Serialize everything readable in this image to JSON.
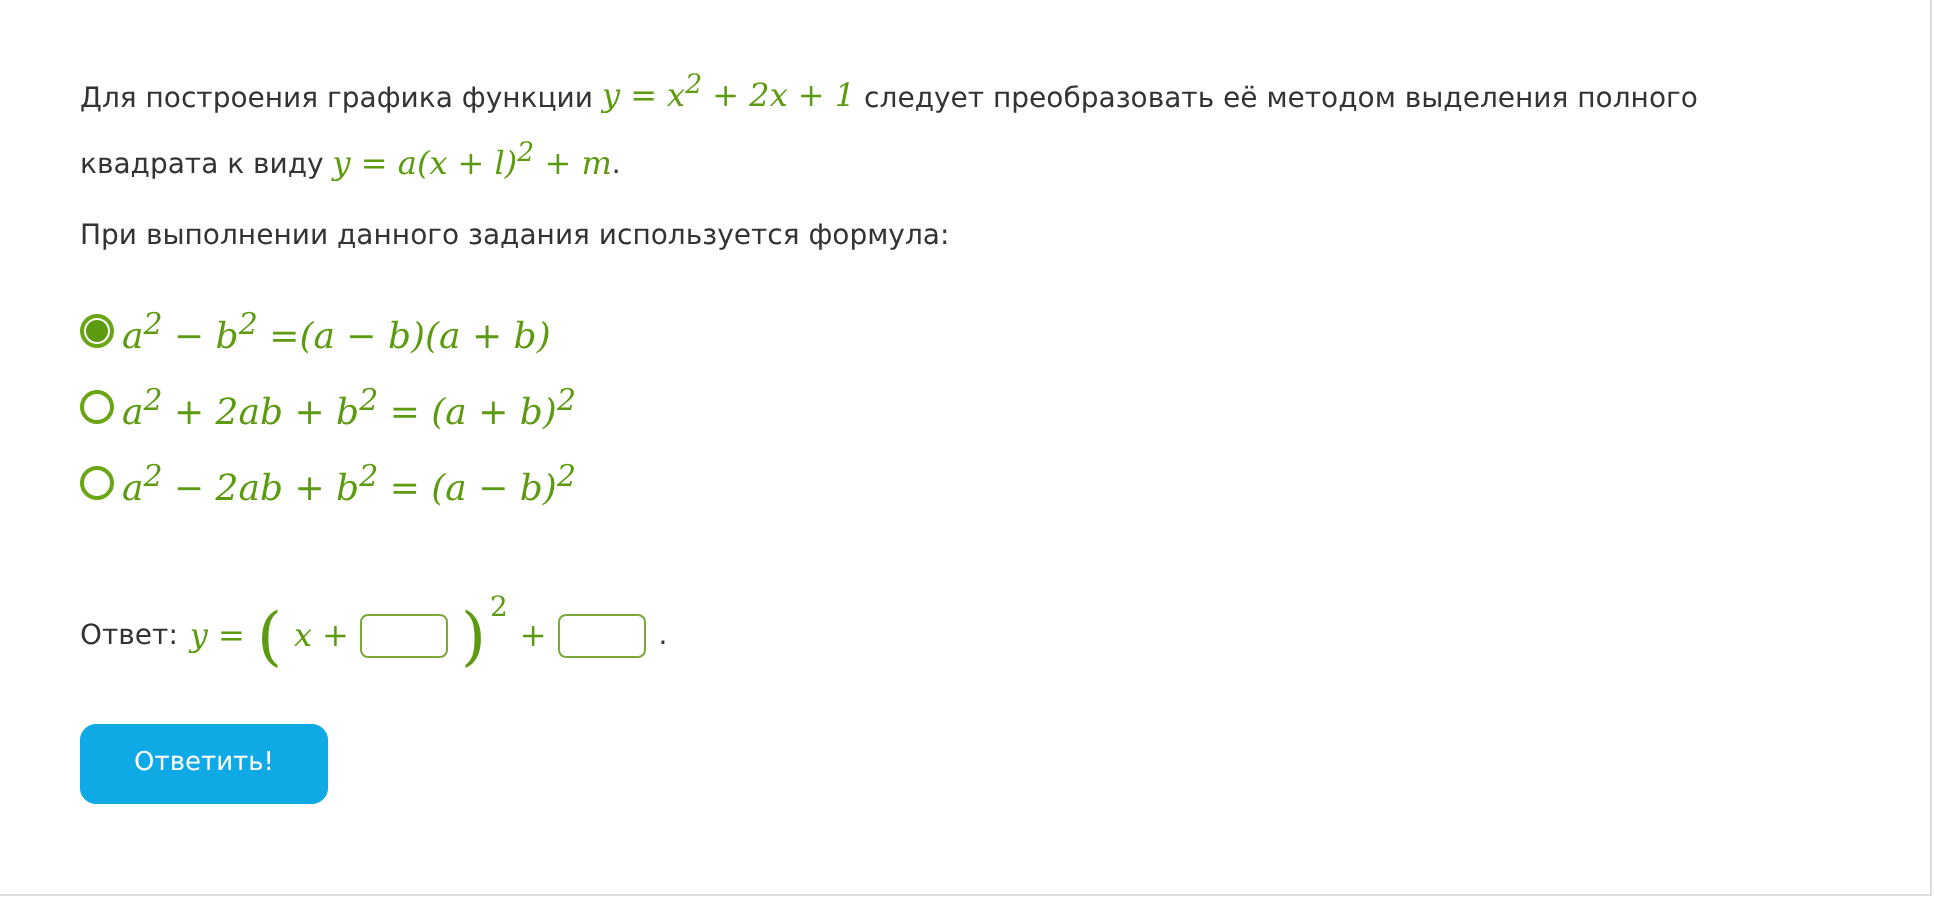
{
  "problem": [
    {
      "kind": "text",
      "text": "Для построения графика функции "
    },
    {
      "kind": "math",
      "text": "y = x$^{2}$ + 2x + 1"
    },
    {
      "kind": "text",
      "text": " следует преобразовать её методом выделения полного квадрата к виду "
    },
    {
      "kind": "math",
      "text": "y = a(x + l)$^{2}$ + m"
    },
    {
      "kind": "text",
      "text": "."
    }
  ],
  "prompt": "При выполнении данного задания используется формула:",
  "options": [
    {
      "formula": "a$^{2}$ − b$^{2}$ =(a − b)(a + b)",
      "selected": true
    },
    {
      "formula": "a$^{2}$ + 2ab + b$^{2}$ = (a + b)$^{2}$",
      "selected": false
    },
    {
      "formula": "a$^{2}$ − 2ab + b$^{2}$ = (a − b)$^{2}$",
      "selected": false
    }
  ],
  "answer": {
    "label": "Ответ:",
    "parts": [
      {
        "kind": "math",
        "text": "y ="
      },
      {
        "kind": "paren",
        "text": "("
      },
      {
        "kind": "math",
        "text": "x +"
      },
      {
        "kind": "field"
      },
      {
        "kind": "paren",
        "text": ")"
      },
      {
        "kind": "power",
        "text": "2"
      },
      {
        "kind": "math",
        "text": "+"
      },
      {
        "kind": "field"
      },
      {
        "kind": "text",
        "text": "."
      }
    ]
  },
  "submit": "Ответить!"
}
